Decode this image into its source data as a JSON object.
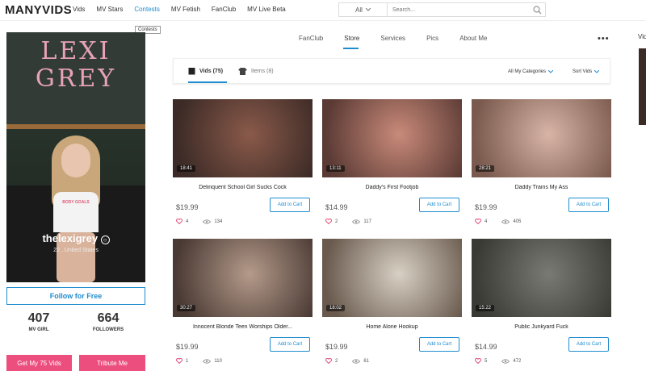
{
  "header": {
    "logo": "MANYVIDS",
    "nav": [
      "Vids",
      "MV Stars",
      "Contests",
      "MV Fetish",
      "FanClub",
      "MV Live Beta"
    ],
    "active_nav": "Contests",
    "search_scope": "All",
    "search_placeholder": "Search...",
    "tooltip": "Contests"
  },
  "profile": {
    "chalk_line1": "LEXI",
    "chalk_line2": "GREY",
    "shirt_text": "BODY GOALS",
    "username": "thelexigrey",
    "location": "22 , United States",
    "follow_label": "Follow for Free",
    "stats": [
      {
        "num": "407",
        "label": "MV GIRL"
      },
      {
        "num": "664",
        "label": "FOLLOWERS"
      }
    ],
    "buy_label": "Get My 75 Vids",
    "tribute_label": "Tribute Me"
  },
  "tabs": [
    "FanClub",
    "Store",
    "Services",
    "Pics",
    "About Me"
  ],
  "active_tab": "Store",
  "side_label": "Vid",
  "filters": {
    "vids_tab": "Vids (75)",
    "items_tab": "Items (8)",
    "categories": "All My Categories",
    "sort": "Sort Vids"
  },
  "cart_label": "Add to Cart",
  "videos": [
    {
      "title": "Delinquent School Girl Sucks Cock",
      "duration": "18:41",
      "price": "$19.99",
      "likes": "4",
      "views": "134",
      "bg": "#8a5a4a",
      "bg2": "#3b2a26"
    },
    {
      "title": "Daddy's First Footjob",
      "duration": "13:11",
      "price": "$14.99",
      "likes": "2",
      "views": "117",
      "bg": "#c98a7a",
      "bg2": "#5a3a34"
    },
    {
      "title": "Daddy Trains My Ass",
      "duration": "28:21",
      "price": "$19.99",
      "likes": "4",
      "views": "405",
      "bg": "#d7b4a6",
      "bg2": "#7a5a4e"
    },
    {
      "title": "Innocent Blonde Teen Worships Older...",
      "duration": "30:27",
      "price": "$19.99",
      "likes": "1",
      "views": "110",
      "bg": "#b49a8a",
      "bg2": "#4a3a34"
    },
    {
      "title": "Home Alone Hookup",
      "duration": "18:02",
      "price": "$19.99",
      "likes": "2",
      "views": "61",
      "bg": "#d8d0c4",
      "bg2": "#6a5a4e"
    },
    {
      "title": "Public Junkyard Fuck",
      "duration": "15:22",
      "price": "$14.99",
      "likes": "5",
      "views": "472",
      "bg": "#7a7a74",
      "bg2": "#3a3a34"
    }
  ]
}
